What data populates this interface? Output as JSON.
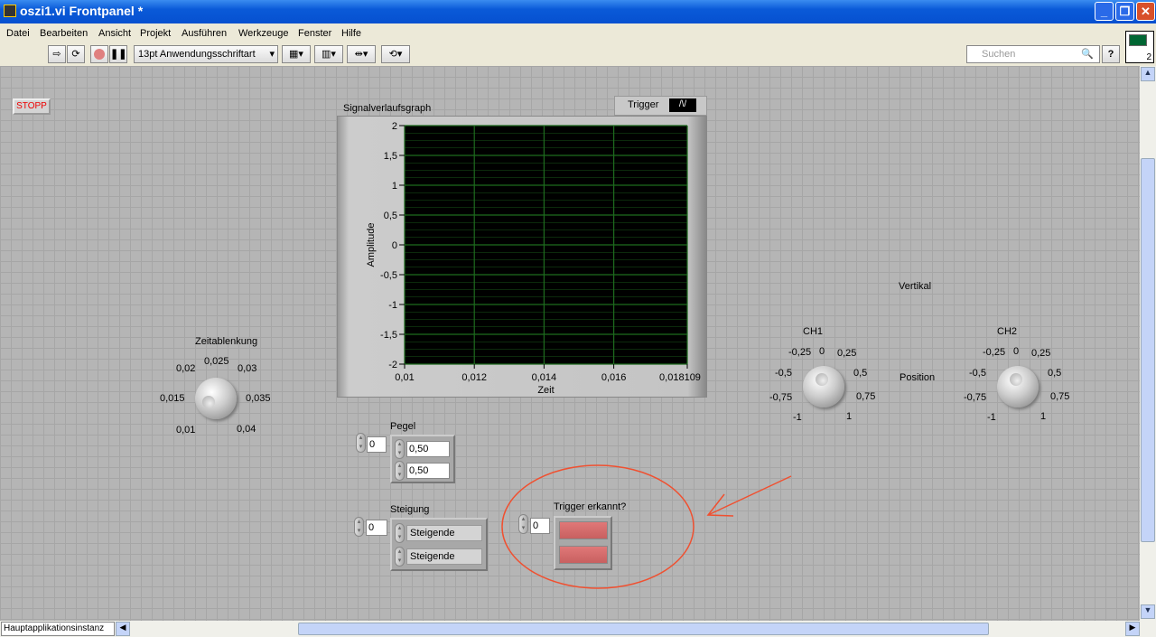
{
  "window": {
    "title": "oszi1.vi Frontpanel *"
  },
  "menu": [
    "Datei",
    "Bearbeiten",
    "Ansicht",
    "Projekt",
    "Ausführen",
    "Werkzeuge",
    "Fenster",
    "Hilfe"
  ],
  "toolbar": {
    "font": "13pt Anwendungsschriftart",
    "search_placeholder": "Suchen",
    "help": "?",
    "connector_count": "2"
  },
  "controls": {
    "stop": "STOPP",
    "zeitablenkung": {
      "label": "Zeitablenkung",
      "ticks": [
        "0,01",
        "0,015",
        "0,02",
        "0,025",
        "0,03",
        "0,035",
        "0,04"
      ]
    },
    "vertikal": "Vertikal",
    "position": "Position",
    "ch1": {
      "label": "CH1",
      "ticks": [
        "-1",
        "-0,75",
        "-0,5",
        "-0,25",
        "0",
        "0,25",
        "0,5",
        "0,75",
        "1"
      ]
    },
    "ch2": {
      "label": "CH2",
      "ticks": [
        "-1",
        "-0,75",
        "-0,5",
        "-0,25",
        "0",
        "0,25",
        "0,5",
        "0,75",
        "1"
      ]
    },
    "pegel": {
      "label": "Pegel",
      "index": "0",
      "values": [
        "0,50",
        "0,50"
      ]
    },
    "steigung": {
      "label": "Steigung",
      "index": "0",
      "values": [
        "Steigende",
        "Steigende"
      ]
    },
    "trigger_erkannt": {
      "label": "Trigger erkannt?",
      "index": "0"
    }
  },
  "chart_data": {
    "type": "line",
    "title": "Signalverlaufsgraph",
    "legend": "Trigger",
    "xlabel": "Zeit",
    "ylabel": "Amplitude",
    "xlim": [
      0.01,
      0.018109
    ],
    "ylim": [
      -2,
      2
    ],
    "xticks": [
      "0,01",
      "0,012",
      "0,014",
      "0,016",
      "0,018109"
    ],
    "yticks": [
      "2",
      "1,5",
      "1",
      "0,5",
      "0",
      "-0,5",
      "-1",
      "-1,5",
      "-2"
    ],
    "series": [],
    "grid": true,
    "background": "#000000",
    "grid_color": "#1e6b1e"
  },
  "status": {
    "instance": "Hauptapplikationsinstanz"
  },
  "annotation_color": "#f05030"
}
